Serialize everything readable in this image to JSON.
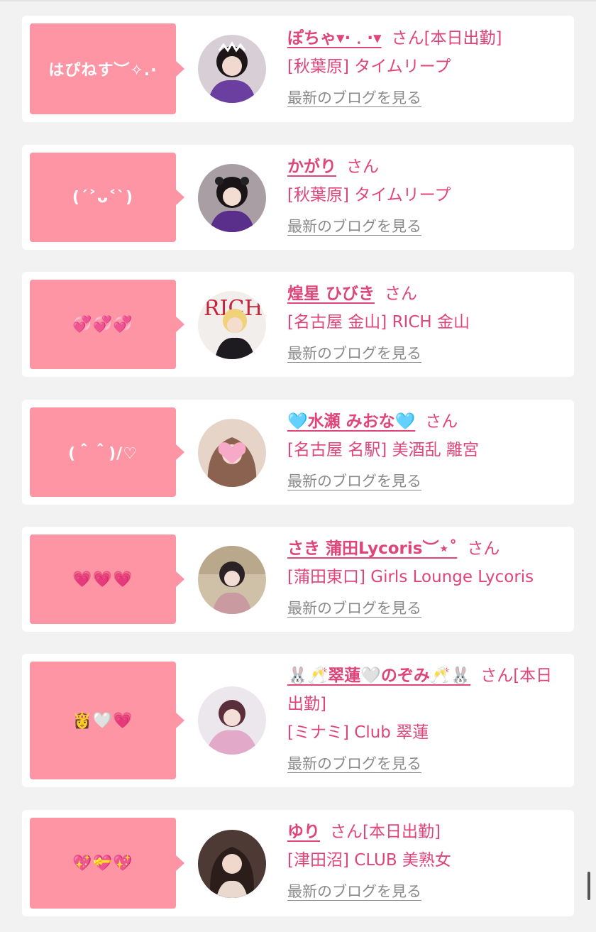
{
  "suffix": "さん",
  "blog_link": "最新のブログを見る",
  "entries": [
    {
      "comment": "はぴねす︶✧.·",
      "name": "ぽちゃ▾·﹒·▾",
      "status": "[本日出勤]",
      "shop": "[秋葉原] タイムリープ"
    },
    {
      "comment": "(ˊ˃ᴗ˂ˋ)",
      "name": "かがり",
      "status": "",
      "shop": "[秋葉原] タイムリープ"
    },
    {
      "comment": "💞💞💞",
      "name": "煌星 ひびき",
      "status": "",
      "shop": "[名古屋 金山] RICH 金山"
    },
    {
      "comment": "(＾＾)/♡",
      "name": "🩵水瀬 みおな🩵",
      "status": "",
      "shop": "[名古屋 名駅] 美酒乱 離宮"
    },
    {
      "comment": "💗💗💗",
      "name": "さき 蒲田Lycoris︶⋆˚",
      "status": "",
      "shop": "[蒲田東口] Girls Lounge Lycoris"
    },
    {
      "comment": "👸🤍💗",
      "name": "🐰🥂翠蓮🤍のぞみ🥂🐰",
      "status": "[本日出勤]",
      "shop": "[ミナミ] Club 翠蓮"
    },
    {
      "comment": "💖💝💖",
      "name": "ゆり",
      "status": "[本日出勤]",
      "shop": "[津田沼] CLUB 美熟女"
    }
  ]
}
